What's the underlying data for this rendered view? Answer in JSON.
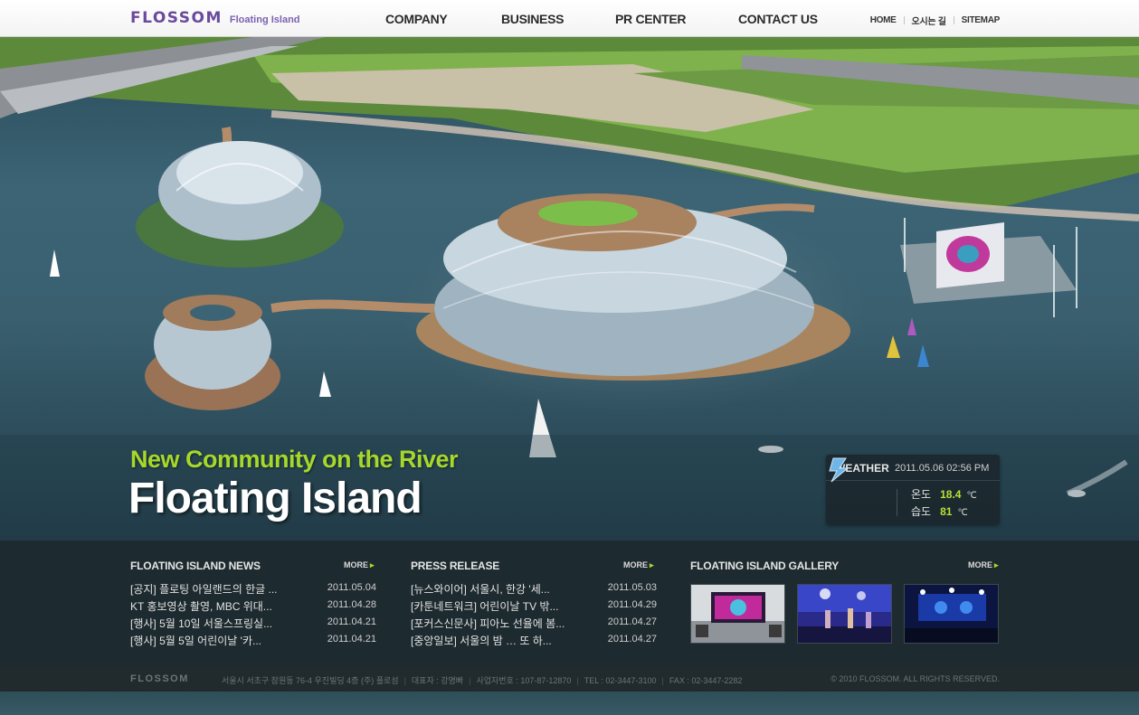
{
  "header": {
    "logo": "FLOSSOM",
    "logo_sub": "Floating Island",
    "nav": [
      "COMPANY",
      "BUSINESS",
      "PR CENTER",
      "CONTACT US"
    ],
    "util": [
      "HOME",
      "오시는 길",
      "SITEMAP"
    ]
  },
  "hero": {
    "tagline": "New Community on the River",
    "title": "Floating Island"
  },
  "weather": {
    "title": "WEATHER",
    "datetime": "2011.05.06 02:56 PM",
    "temp_label": "온도",
    "temp_value": "18.4",
    "temp_unit": "℃",
    "humidity_label": "습도",
    "humidity_value": "81",
    "humidity_unit": "℃"
  },
  "news": {
    "title": "FLOATING ISLAND NEWS",
    "more": "MORE",
    "items": [
      {
        "title": "[공지] 플로팅 아일랜드의 한글 ...",
        "date": "2011.05.04"
      },
      {
        "title": "KT 홍보영상 촬영, MBC 위대...",
        "date": "2011.04.28"
      },
      {
        "title": "[행사] 5월 10일 서울스프링실...",
        "date": "2011.04.21"
      },
      {
        "title": "[행사] 5월 5일 어린이날 '카...",
        "date": "2011.04.21"
      }
    ]
  },
  "press": {
    "title": "PRESS RELEASE",
    "more": "MORE",
    "items": [
      {
        "title": "[뉴스와이어] 서울시, 한강 '세...",
        "date": "2011.05.03"
      },
      {
        "title": "[카툰네트워크] 어린이날 TV 밖...",
        "date": "2011.04.29"
      },
      {
        "title": "[포커스신문사] 피아노 선율에 봄...",
        "date": "2011.04.27"
      },
      {
        "title": "[중앙일보] 서울의 밤 … 또 하...",
        "date": "2011.04.27"
      }
    ]
  },
  "gallery": {
    "title": "FLOATING ISLAND GALLERY",
    "more": "MORE"
  },
  "footer": {
    "logo": "FLOSSOM",
    "address": "서울시 서초구 잠원동 76-4 우진빌딩 4층 (주) 플로섬",
    "ceo": "대표자 : 강명빠",
    "biz_no": "사업자번호 : 107-87-12870",
    "tel": "TEL : 02-3447-3100",
    "fax": "FAX : 02-3447-2282",
    "copyright": "© 2010 FLOSSOM. ALL RIGHTS RESERVED."
  },
  "colors": {
    "brand_purple": "#6a4a9c",
    "accent_green": "#a6d82c"
  }
}
